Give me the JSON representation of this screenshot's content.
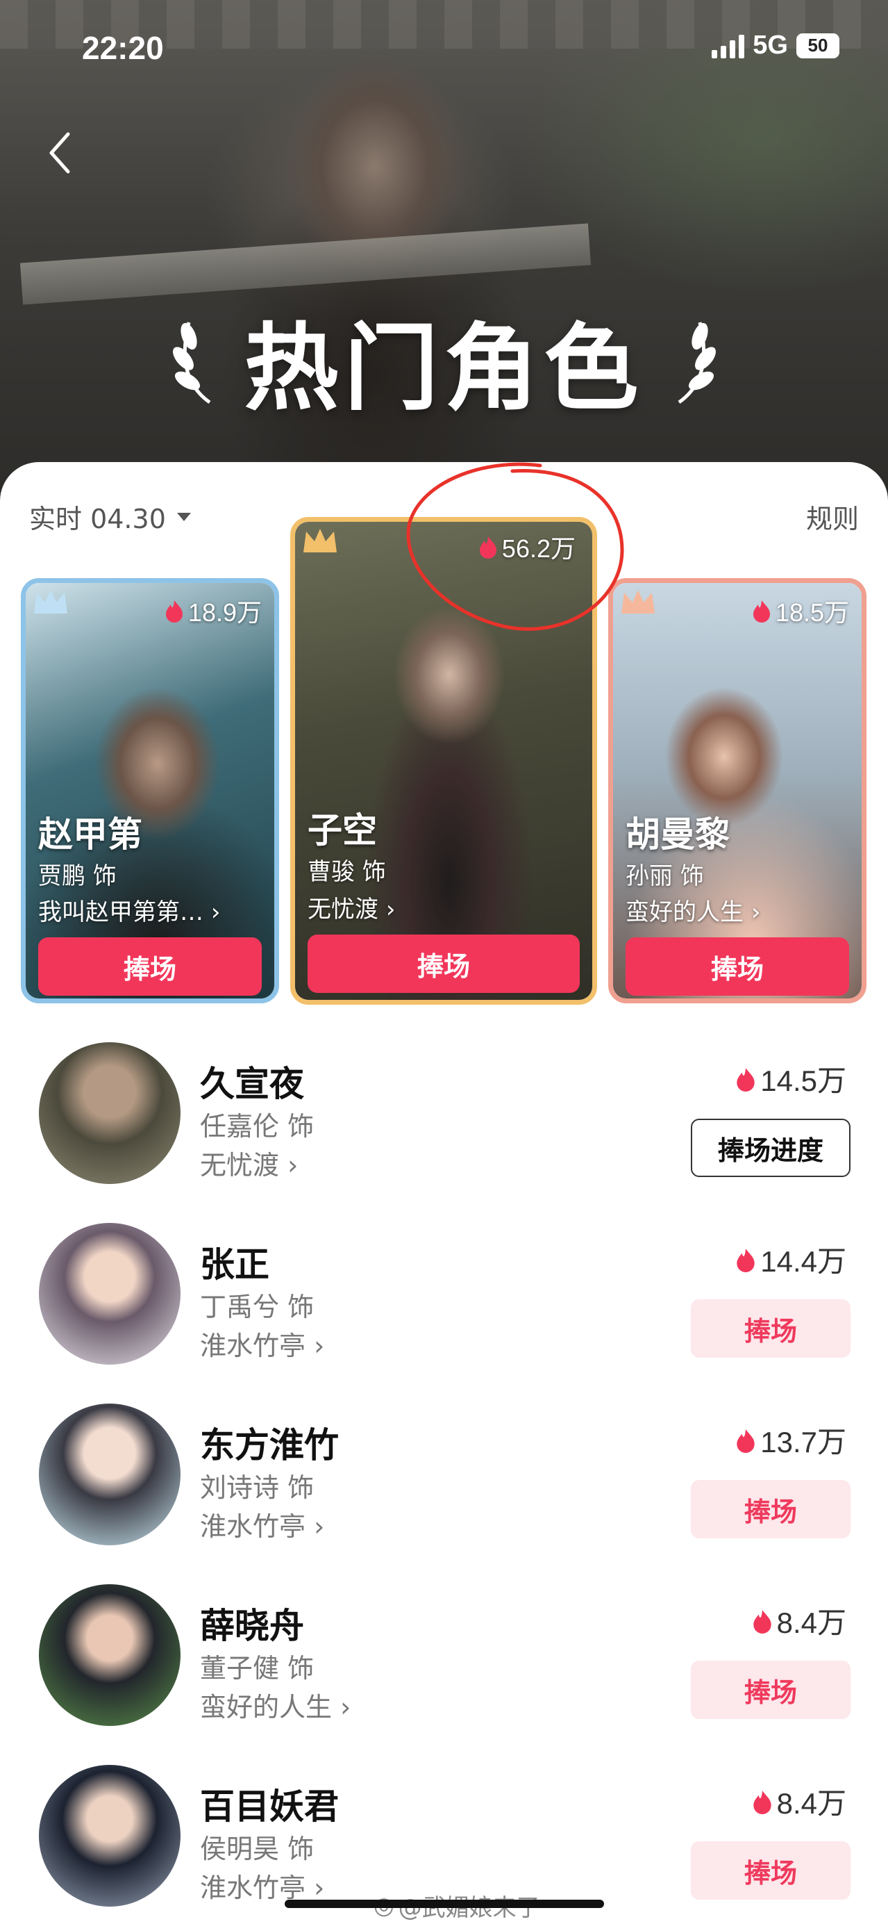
{
  "status_bar": {
    "time": "22:20",
    "network": "5G",
    "battery": "50"
  },
  "header": {
    "title": "热门角色"
  },
  "controls": {
    "date_label": "实时 04.30",
    "rules_label": "规则"
  },
  "top_cards": [
    {
      "rank": 2,
      "heat": "18.9万",
      "name": "赵甲第",
      "actor": "贾鹏 饰",
      "show": "我叫赵甲第第…",
      "button": "捧场"
    },
    {
      "rank": 1,
      "heat": "56.2万",
      "name": "子空",
      "actor": "曹骏 饰",
      "show": "无忧渡",
      "button": "捧场"
    },
    {
      "rank": 3,
      "heat": "18.5万",
      "name": "胡曼黎",
      "actor": "孙丽 饰",
      "show": "蛮好的人生",
      "button": "捧场"
    }
  ],
  "list": [
    {
      "name": "久宣夜",
      "actor": "任嘉伦 饰",
      "show": "无忧渡",
      "heat": "14.5万",
      "button": "捧场进度"
    },
    {
      "name": "张正",
      "actor": "丁禹兮 饰",
      "show": "淮水竹亭",
      "heat": "14.4万",
      "button": "捧场"
    },
    {
      "name": "东方淮竹",
      "actor": "刘诗诗 饰",
      "show": "淮水竹亭",
      "heat": "13.7万",
      "button": "捧场"
    },
    {
      "name": "薛晓舟",
      "actor": "董子健 饰",
      "show": "蛮好的人生",
      "heat": "8.4万",
      "button": "捧场"
    },
    {
      "name": "百目妖君",
      "actor": "侯明昊 饰",
      "show": "淮水竹亭",
      "heat": "8.4万",
      "button": "捧场"
    }
  ],
  "watermark": "@武媚娘来了",
  "colors": {
    "accent": "#f2365a",
    "soft_button": "#fde8ec",
    "gold_border": "#f2c06a",
    "blue_border": "#8ec3e8",
    "pink_border": "#f0a090",
    "annotation": "#e8322a"
  },
  "icons": [
    "back-arrow-icon",
    "dropdown-caret-icon",
    "laurel-left-icon",
    "laurel-right-icon",
    "crown-icon",
    "flame-icon",
    "chevron-right-icon"
  ]
}
